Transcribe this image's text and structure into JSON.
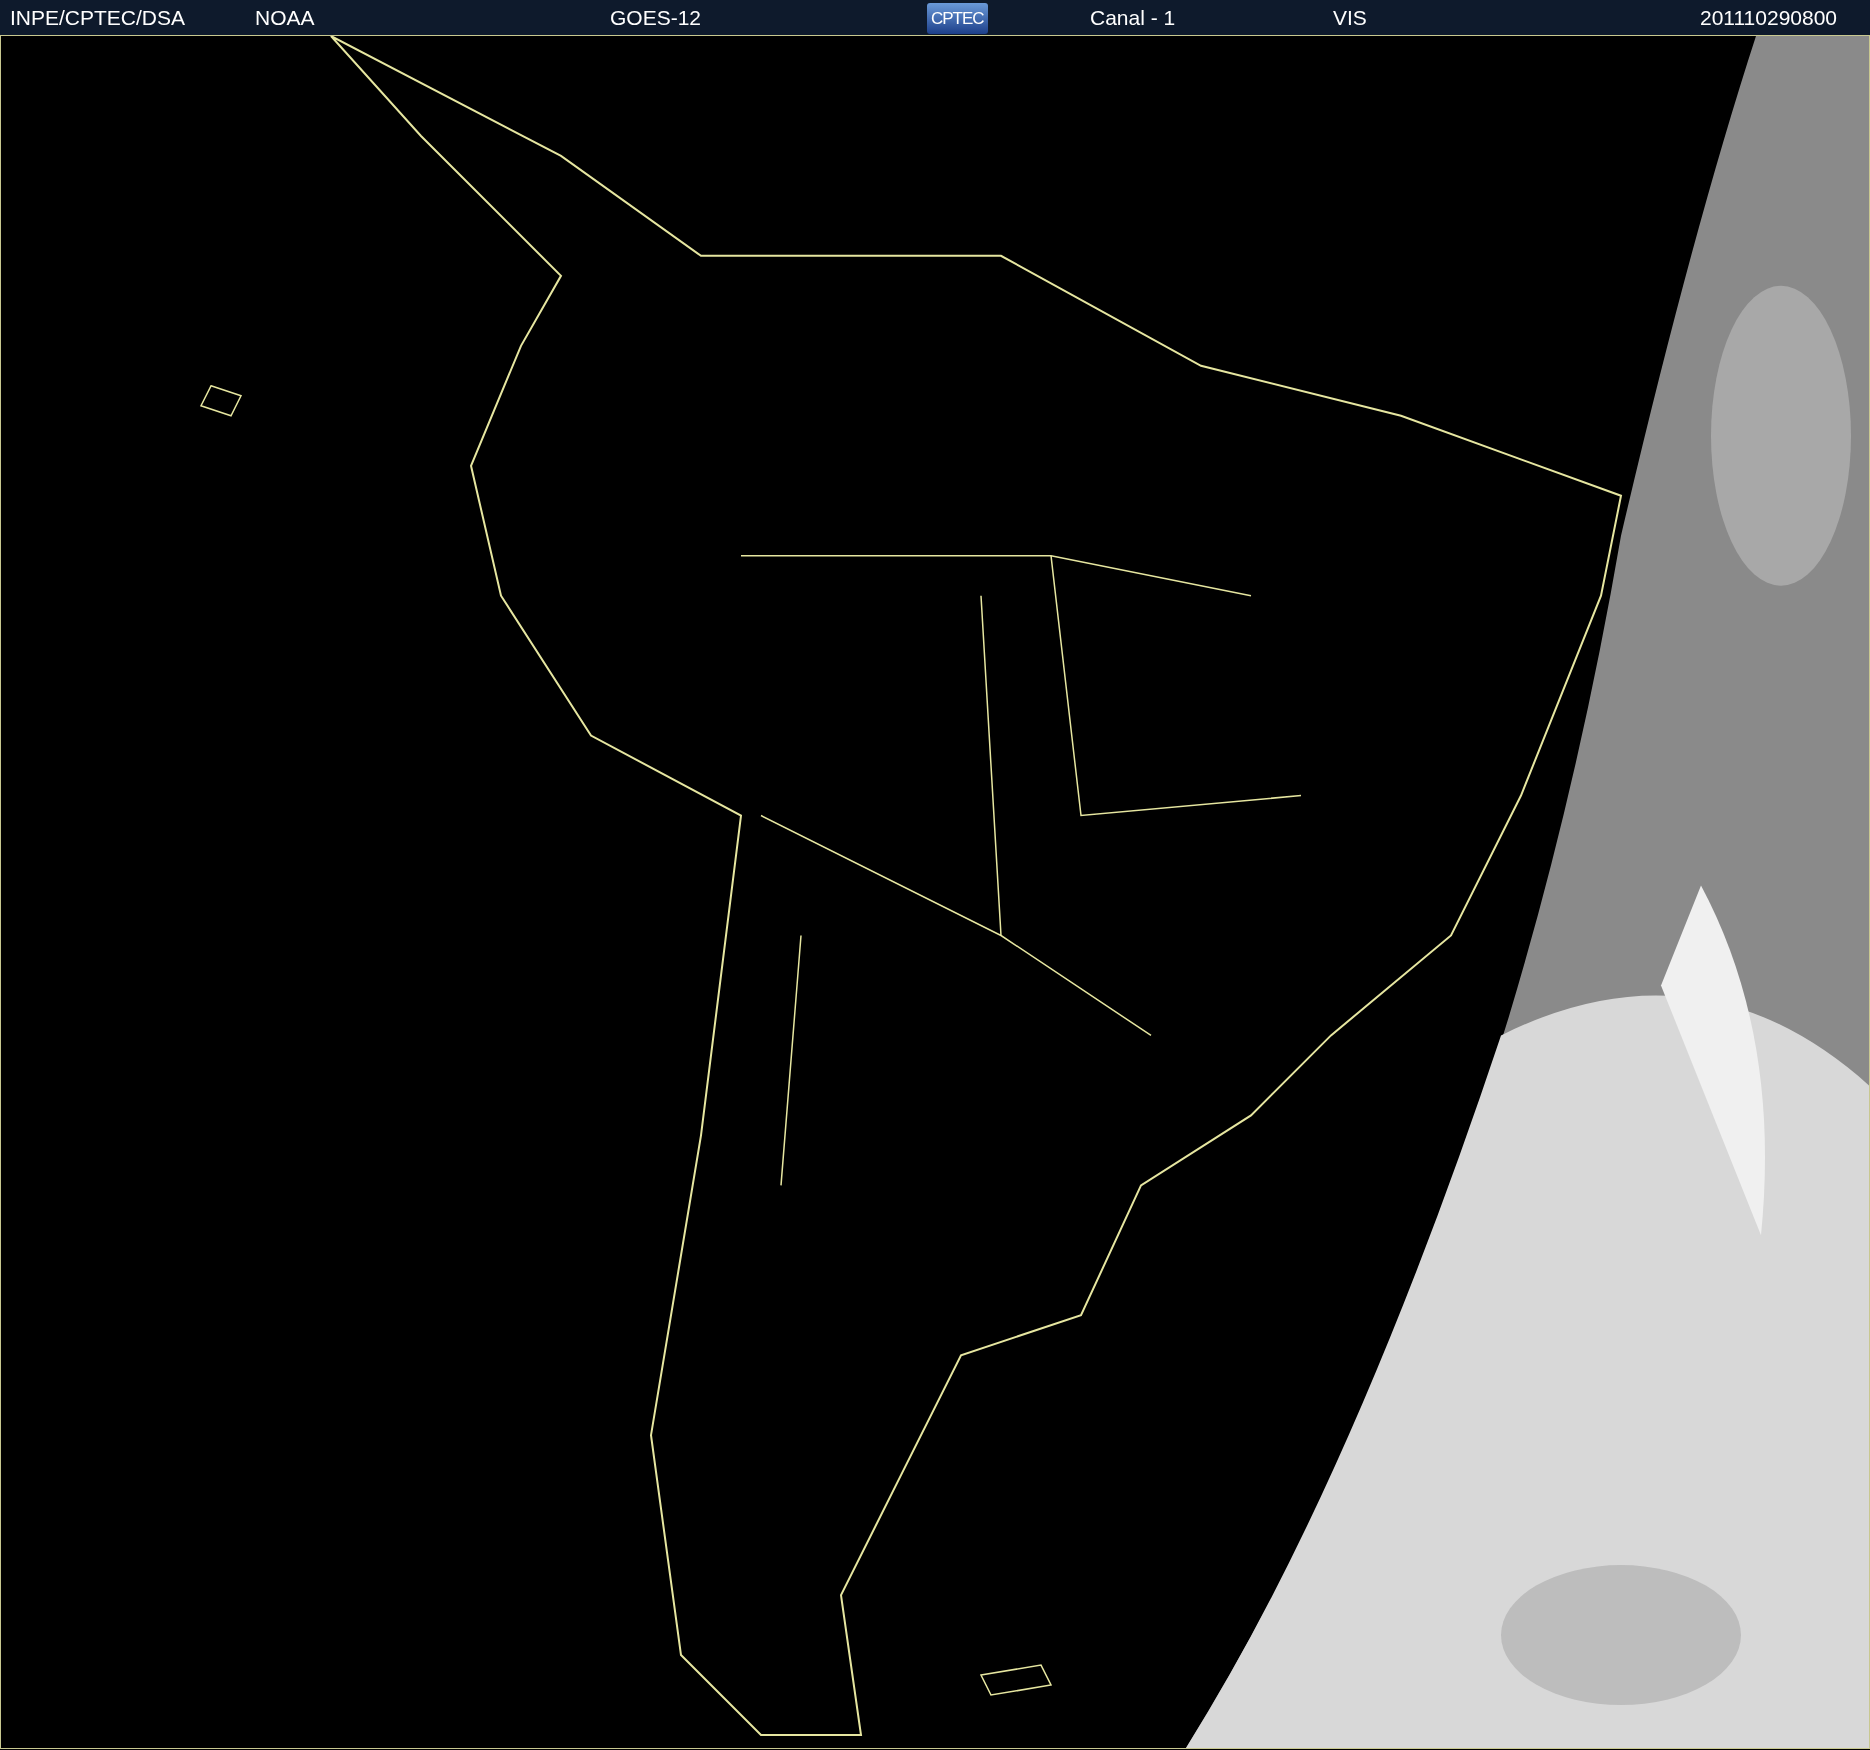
{
  "header": {
    "items": [
      {
        "kind": "text",
        "text": "INPE/CPTEC/DSA"
      },
      {
        "kind": "text",
        "text": "NOAA"
      },
      {
        "kind": "text",
        "text": "GOES-12"
      },
      {
        "kind": "logo",
        "text": "CPTEC"
      },
      {
        "kind": "text",
        "text": "Canal - 1"
      },
      {
        "kind": "text",
        "text": "VIS"
      },
      {
        "kind": "text",
        "text": "201110290800"
      }
    ]
  }
}
